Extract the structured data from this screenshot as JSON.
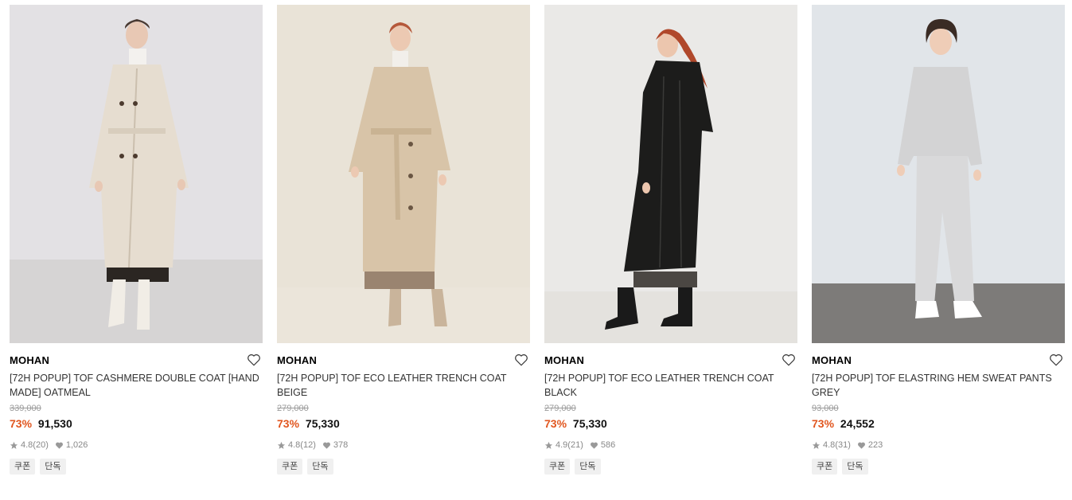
{
  "products": [
    {
      "brand": "MOHAN",
      "title": "[72H POPUP] TOF CASHMERE DOUBLE COAT [HAND MADE] OATMEAL",
      "original_price": "339,000",
      "discount": "73%",
      "price": "91,530",
      "rating": "4.8",
      "reviews": "(20)",
      "likes": "1,026",
      "tags": [
        "쿠폰",
        "단독"
      ]
    },
    {
      "brand": "MOHAN",
      "title": "[72H POPUP] TOF ECO LEATHER TRENCH COAT BEIGE",
      "original_price": "279,000",
      "discount": "73%",
      "price": "75,330",
      "rating": "4.8",
      "reviews": "(12)",
      "likes": "378",
      "tags": [
        "쿠폰",
        "단독"
      ]
    },
    {
      "brand": "MOHAN",
      "title": "[72H POPUP] TOF ECO LEATHER TRENCH COAT BLACK",
      "original_price": "279,000",
      "discount": "73%",
      "price": "75,330",
      "rating": "4.9",
      "reviews": "(21)",
      "likes": "586",
      "tags": [
        "쿠폰",
        "단독"
      ]
    },
    {
      "brand": "MOHAN",
      "title": "[72H POPUP] TOF ELASTRING HEM SWEAT PANTS GREY",
      "original_price": "93,000",
      "discount": "73%",
      "price": "24,552",
      "rating": "4.8",
      "reviews": "(31)",
      "likes": "223",
      "tags": [
        "쿠폰",
        "단독"
      ]
    }
  ],
  "colors": {
    "discount": "#e1561f",
    "strike_price": "#9a9a9a",
    "tag_bg": "#f0f0f0"
  },
  "icons": {
    "wishlist": "heart-outline-icon",
    "rating": "star-icon",
    "likes": "heart-filled-icon"
  }
}
